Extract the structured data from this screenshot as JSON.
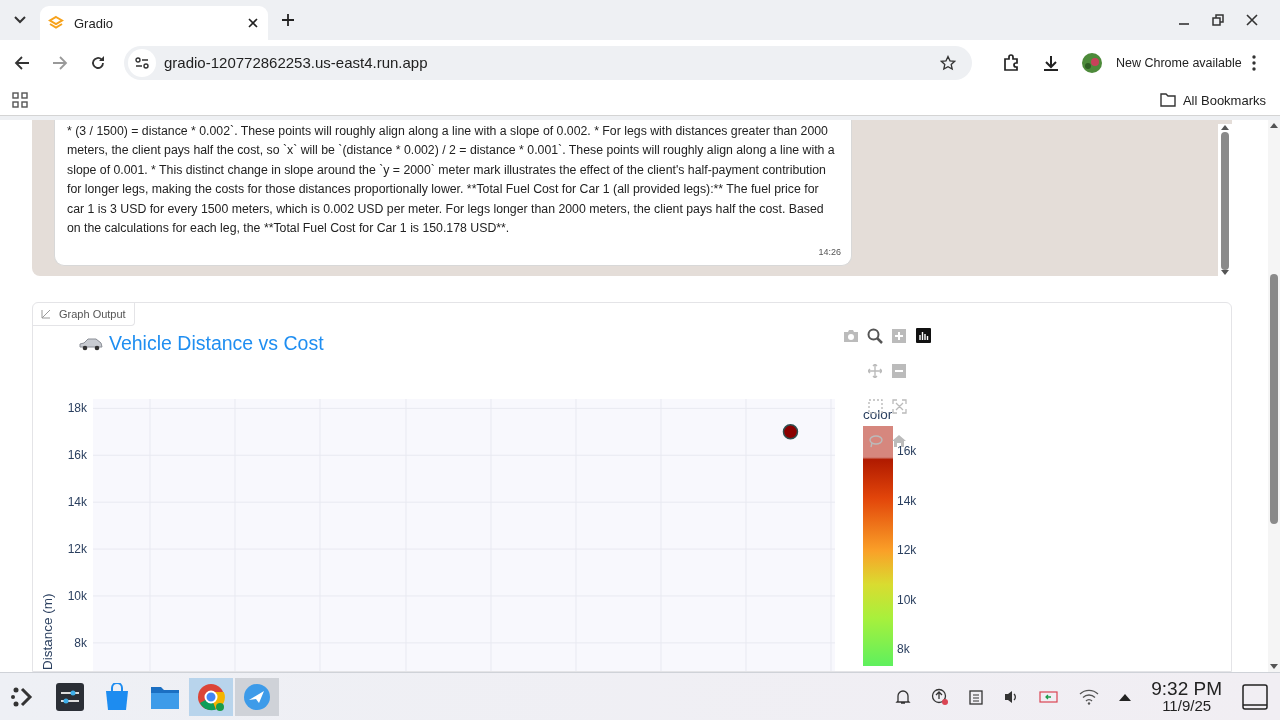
{
  "browser": {
    "tabs": [
      {
        "title": "Gradio",
        "selected": true
      }
    ],
    "url": "gradio-120772862253.us-east4.run.app",
    "update_label": "New Chrome available",
    "bookmarks": [
      {
        "label": "All Bookmarks"
      }
    ]
  },
  "chat": {
    "messages": [
      {
        "text": "* (3 / 1500) = distance * 0.002`. These points will roughly align along a line with a slope of 0.002. * For legs with distances greater than 2000 meters, the client pays half the cost, so `x` will be `(distance * 0.002) / 2 = distance * 0.001`. These points will roughly align along a line with a slope of 0.001. * This distinct change in slope around the `y = 2000` meter mark illustrates the effect of the client's half-payment contribution for longer legs, making the costs for those distances proportionally lower. **Total Fuel Cost for Car 1 (all provided legs):** The fuel price for car 1 is 3 USD for every 1500 meters, which is 0.002 USD per meter. For legs longer than 2000 meters, the client pays half the cost. Based on the calculations for each leg, the **Total Fuel Cost for Car 1 is 150.178 USD**.",
        "time": "14:26"
      }
    ]
  },
  "graph": {
    "label": "Graph Output",
    "title": "Vehicle Distance vs Cost",
    "chart_data": {
      "type": "scatter",
      "grid": true,
      "ylabel": "Distance (m)",
      "ylim": [
        6800,
        18400
      ],
      "yticks": [
        {
          "value": 8000,
          "label": "8k"
        },
        {
          "value": 10000,
          "label": "10k"
        },
        {
          "value": 12000,
          "label": "12k"
        },
        {
          "value": 14000,
          "label": "14k"
        },
        {
          "value": 16000,
          "label": "16k"
        },
        {
          "value": 18000,
          "label": "18k"
        }
      ],
      "series": [
        {
          "name": "color",
          "color": "#8b0000",
          "values": [
            17000
          ]
        }
      ]
    },
    "colorbar": {
      "ticks": [
        "16k",
        "14k",
        "12k",
        "10k",
        "8k"
      ]
    }
  },
  "taskbar": {
    "time": "9:32 PM",
    "date": "11/9/25"
  }
}
